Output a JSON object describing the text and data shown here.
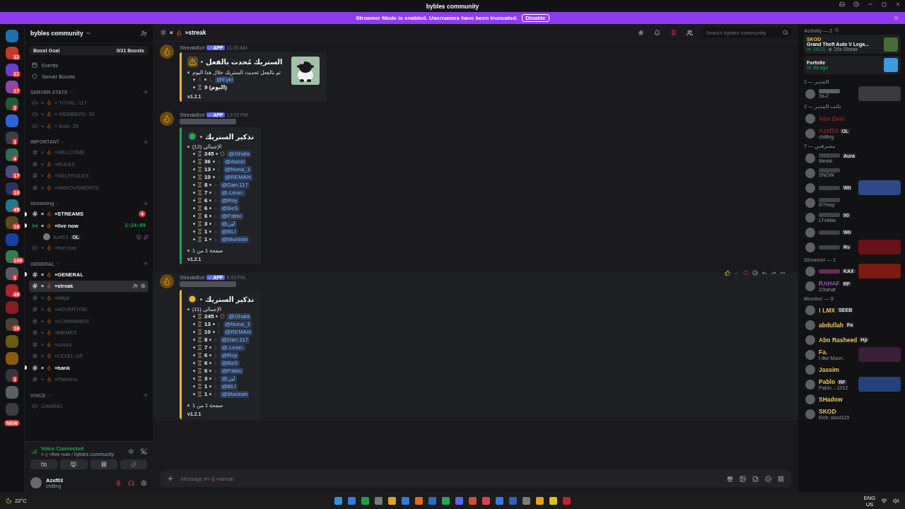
{
  "window": {
    "title": "bybles community"
  },
  "banner": {
    "text": "Streamer Mode is enabled. Usernames have been truncated.",
    "button": "Disable"
  },
  "servers": [
    {
      "color": "#1f6fb5"
    },
    {
      "color": "#c0392b",
      "badge": "11"
    },
    {
      "color": "#6a3fc9",
      "badge": "11"
    },
    {
      "color": "#8e44ad",
      "badge": "27"
    },
    {
      "color": "#1d5b3a",
      "badge": "2"
    },
    {
      "color": "#2d63d8"
    },
    {
      "color": "#3a3f47",
      "badge": "1"
    },
    {
      "color": "#2a6f5a",
      "badge": "4"
    },
    {
      "color": "#4c4f7a",
      "badge": "17"
    },
    {
      "color": "#28345c",
      "badge": "10"
    },
    {
      "color": "#1e7a8c",
      "badge": "45"
    },
    {
      "color": "#5a4a1e",
      "badge": "16"
    },
    {
      "color": "#1b3fa0"
    },
    {
      "color": "#2f7d4f",
      "badge": "109"
    },
    {
      "color": "#555a63",
      "badge": "1"
    },
    {
      "color": "#a8232e",
      "badge": "49"
    },
    {
      "color": "#8a1c24"
    },
    {
      "color": "#4a4436",
      "badge": "16"
    },
    {
      "color": "#6b5a14"
    },
    {
      "color": "#8a5a10"
    },
    {
      "color": "#33363d",
      "badge": "1"
    },
    {
      "color": "#5c5f66"
    },
    {
      "color": "#3a3d44"
    }
  ],
  "new_badge": "NEW",
  "sidebar": {
    "server_name": "bybles community",
    "boost": {
      "label": "Boost Goal",
      "count": "0/31 Boosts"
    },
    "links": [
      {
        "kind": "events",
        "label": "Events"
      },
      {
        "kind": "boosts",
        "label": "Server Boosts"
      }
    ],
    "categories": [
      {
        "name": "SERVER STATS",
        "channels": [
          {
            "kind": "voice",
            "lead": "«",
            "name": "» TOTAL: 117",
            "unread": false,
            "selected": false
          },
          {
            "kind": "voice",
            "lead": "«",
            "name": "» MEMBERS: 92",
            "unread": false,
            "selected": false
          },
          {
            "kind": "voice",
            "lead": "«",
            "name": "» Bots: 25",
            "unread": false,
            "selected": false
          }
        ]
      },
      {
        "name": "IMPORTANT",
        "channels": [
          {
            "kind": "text",
            "lead": "«",
            "name": "»WELCOME",
            "unread": false,
            "selected": false
          },
          {
            "kind": "text",
            "lead": "«",
            "name": "»RULES",
            "unread": false,
            "selected": false
          },
          {
            "kind": "text",
            "lead": "«",
            "name": "»SELFROLES",
            "unread": false,
            "selected": false
          },
          {
            "kind": "text",
            "lead": "«",
            "name": "»ANNOUSMENTS",
            "unread": false,
            "selected": false
          }
        ]
      },
      {
        "name": "streaming",
        "channels": [
          {
            "kind": "text",
            "lead": "«",
            "name": "»STREAMS",
            "unread": true,
            "selected": false,
            "badge": "4"
          },
          {
            "kind": "live",
            "lead": "«",
            "name": "»live now",
            "unread": true,
            "selected": false,
            "timer": "2:24:09",
            "users": [
              {
                "name": "Azxf03",
                "tag": "OL"
              }
            ]
          },
          {
            "kind": "voice",
            "lead": "«",
            "name": "»live now",
            "unread": false,
            "selected": false
          }
        ]
      },
      {
        "name": "GENERAL",
        "channels": [
          {
            "kind": "text",
            "lead": "«",
            "name": "»GENERAL",
            "unread": true,
            "selected": false
          },
          {
            "kind": "text",
            "lead": "«",
            "name": "»streak",
            "unread": false,
            "selected": true
          },
          {
            "kind": "text",
            "lead": "«",
            "name": "»tklijat",
            "unread": false,
            "selected": false
          },
          {
            "kind": "text",
            "lead": "«",
            "name": "»ADVERTISE",
            "unread": false,
            "selected": false
          },
          {
            "kind": "text",
            "lead": "«",
            "name": "»COMMANDS",
            "unread": false,
            "selected": false
          },
          {
            "kind": "text",
            "lead": "«",
            "name": "»MEMES",
            "unread": false,
            "selected": false
          },
          {
            "kind": "text",
            "lead": "«",
            "name": "»colors",
            "unread": false,
            "selected": false
          },
          {
            "kind": "text",
            "lead": "«",
            "name": "»LEVEL-UP",
            "unread": false,
            "selected": false
          },
          {
            "kind": "text",
            "lead": "«",
            "name": "»bank",
            "unread": true,
            "selected": false
          },
          {
            "kind": "text",
            "lead": "«",
            "name": "»Partners",
            "unread": false,
            "selected": false
          }
        ]
      },
      {
        "name": "VOICE",
        "channels": [
          {
            "kind": "voice",
            "name": "GAMING",
            "unread": false,
            "selected": false
          }
        ]
      }
    ]
  },
  "voice_panel": {
    "status": "Voice Connected",
    "lead": "«",
    "channel": "»live now / bybles community"
  },
  "user": {
    "name": "Azxf03",
    "status": "chilling"
  },
  "channel_header": {
    "lead": "«",
    "name": "»streak",
    "search": {
      "placeholder": "Search bybles community"
    }
  },
  "messages": [
    {
      "author": "StreakBot",
      "badge": "APP",
      "time": "11:39 AM",
      "embed": {
        "kind": "warning",
        "color": "#f0b232",
        "title": "الستريك مُحدث بالفعل",
        "thumbnail": true,
        "description": "تم بالفعل تحديث الستريك خلال هذا اليوم",
        "items": [
          {
            "mention": "@Eyki"
          },
          {
            "count": "9 (اليوم)"
          }
        ],
        "footer": "v1.2.1"
      }
    },
    {
      "author": "StreakBot",
      "badge": "APP",
      "time": "12:03 PM",
      "redacted": true,
      "embed": {
        "kind": "reminder",
        "color": "#23a55a",
        "title": "تذكير الستريك",
        "description": "الإجمالي (12)",
        "items": [
          {
            "count": "245",
            "mention": "@Ghala"
          },
          {
            "count": "36",
            "mention": "@Aseel"
          },
          {
            "count": "13",
            "mention": "@Nona_1"
          },
          {
            "count": "10",
            "mention": "@REMAN"
          },
          {
            "count": "8",
            "mention": "@Dan.117"
          },
          {
            "count": "7",
            "mention": "@-Leon-"
          },
          {
            "count": "6",
            "mention": "@Roy"
          },
          {
            "count": "6",
            "mention": "@BeS"
          },
          {
            "count": "6",
            "mention": "@Pablo"
          },
          {
            "count": "3",
            "mention": "@لين"
          },
          {
            "count": "1",
            "mention": "@BLI"
          },
          {
            "count": "1",
            "mention": "@Munirah"
          }
        ],
        "page": "صفحة 1 من 1",
        "footer": "v1.2.1"
      }
    },
    {
      "author": "StreakBot",
      "badge": "APP",
      "time": "6:03 PM",
      "hovered": true,
      "redacted": true,
      "embed": {
        "kind": "reminder",
        "color": "#f0b232",
        "title": "تذكير الستريك",
        "description": "الإجمالي (11)",
        "items": [
          {
            "count": "245",
            "mention": "@Ghala"
          },
          {
            "count": "13",
            "mention": "@Nona_1"
          },
          {
            "count": "10",
            "mention": "@REMAN"
          },
          {
            "count": "8",
            "mention": "@Dan.117"
          },
          {
            "count": "7",
            "mention": "@-Leon-"
          },
          {
            "count": "6",
            "mention": "@Roy"
          },
          {
            "count": "6",
            "mention": "@BeS"
          },
          {
            "count": "6",
            "mention": "@Pablo"
          },
          {
            "count": "3",
            "mention": "@لين"
          },
          {
            "count": "1",
            "mention": "@BLI"
          },
          {
            "count": "1",
            "mention": "@Munirah"
          }
        ],
        "page": "صفحة 1 من 1",
        "footer": "v1.2.1"
      }
    }
  ],
  "composer": {
    "placeholder": "Message #«",
    "placeholder_end": "»streak"
  },
  "members": {
    "activity": {
      "title": "Activity — 2",
      "cards": [
        {
          "user": "SKOD",
          "game": "Grand Theft Auto V Lega...",
          "time": "14:21",
          "extra": "20x Streak",
          "kind": "gta"
        },
        {
          "game": "Fortnite",
          "time": "9d ago",
          "kind": "fortnite"
        }
      ]
    },
    "groups": [
      {
        "title": "المدير — 1",
        "members": [
          {
            "color": "#5c5f66",
            "status": "3a-2",
            "banner": {
              "color": "#3a3a3a"
            }
          }
        ]
      },
      {
        "title": "نائب المدير — 2",
        "members": [
          {
            "name": "Abo Desi",
            "color": "#8a2228"
          },
          {
            "name": "Azxf03",
            "color": "#8a2228",
            "tag": "OL",
            "status": "chilling"
          }
        ]
      },
      {
        "title": "مشرفين — 7",
        "members": [
          {
            "color": "#3f4147",
            "tag": "Aura",
            "status": "Medal"
          },
          {
            "color": "#3f4147",
            "status": "SNOW"
          },
          {
            "color": "#3f4147",
            "tag": "Wii",
            "banner": {
              "color": "#2d4a86"
            }
          },
          {
            "color": "#3f4147",
            "status": "l07mey"
          },
          {
            "color": "#3f4147",
            "tag": "90",
            "status": "LTxMax"
          },
          {
            "color": "#3f4147",
            "tag": "Wii"
          },
          {
            "color": "#3f4147",
            "tag": "Rv",
            "banner": {
              "color": "#6a1018"
            }
          }
        ]
      },
      {
        "title": "Streamer — 2",
        "members": [
          {
            "color": "#6a2b5a",
            "tag": "KAX",
            "banner": {
              "color": "#7a1a10"
            }
          },
          {
            "name": "RAHAF",
            "color": "#8a5ab8",
            "tag": "RF",
            "status": "22rahaf"
          }
        ]
      },
      {
        "title": "Member — 8",
        "members": [
          {
            "name": "! LMX",
            "color": "#e6c35a",
            "tag": "SEEB"
          },
          {
            "name": "abdullah",
            "color": "#e6c35a",
            "tag": "Fa"
          },
          {
            "name": "Abo Rasheed",
            "color": "#e6c35a",
            "tag": "Hp"
          },
          {
            "name": "Fa.",
            "color": "#e6c35a",
            "status": "I like Moon.",
            "banner": {
              "color": "#3a1f3a"
            }
          },
          {
            "name": "Jassim",
            "color": "#e6c35a"
          },
          {
            "name": "Pablo",
            "color": "#e6c35a",
            "tag": "RF",
            "status": "Pablo ...1012",
            "banner": {
              "color": "#25407a"
            }
          },
          {
            "name": "SHadow",
            "color": "#e6c35a"
          },
          {
            "name": "SKOD",
            "color": "#e6c35a",
            "status": "Kick: skod115"
          }
        ]
      }
    ]
  },
  "taskbar": {
    "weather": "22°C",
    "lang": "ENG",
    "region": "US"
  }
}
